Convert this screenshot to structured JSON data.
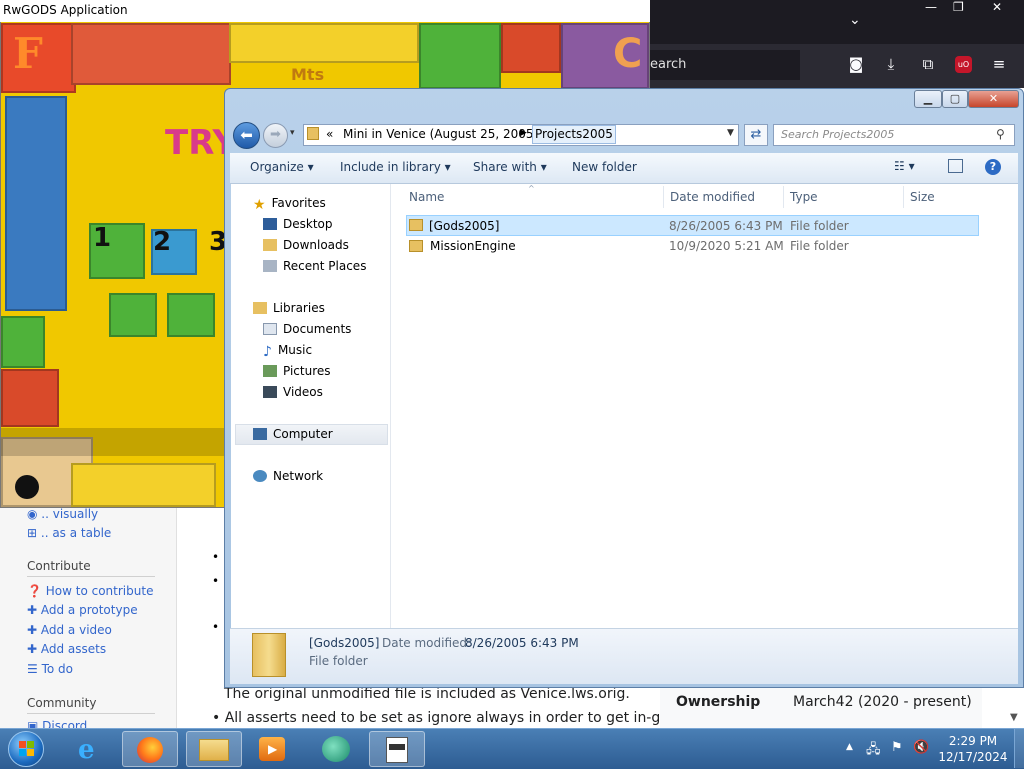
{
  "game_window": {
    "title": "RwGODS Application"
  },
  "browser": {
    "search_placeholder": "earch",
    "icons": [
      "chevron-down-icon",
      "pocket-icon",
      "download-icon",
      "extension-icon",
      "ublock-icon",
      "menu-icon"
    ],
    "window_controls": [
      "—",
      "❐",
      "✕"
    ]
  },
  "wiki": {
    "link_visually": ".. visually",
    "link_table": ".. as a table",
    "contribute_heading": "Contribute",
    "contribute_links": [
      "How to contribute",
      "Add a prototype",
      "Add a video",
      "Add assets",
      "To do"
    ],
    "community_heading": "Community",
    "community_links": [
      "Discord"
    ],
    "content_line1": "The original unmodified file is included as Venice.lws.orig.",
    "content_line2": "All asserts need to be set as ignore always in order to get in-game.",
    "ownership_label": "Ownership",
    "ownership_value": "March42 (2020 - present)"
  },
  "explorer": {
    "breadcrumb_prefix": "«",
    "breadcrumb": [
      "Mini in Venice (August 25, 2005)",
      "Projects2005"
    ],
    "search_placeholder": "Search Projects2005",
    "toolbar": [
      "Organize",
      "Include in library",
      "Share with",
      "New folder"
    ],
    "nav": {
      "favorites": "Favorites",
      "favorites_items": [
        "Desktop",
        "Downloads",
        "Recent Places"
      ],
      "libraries": "Libraries",
      "libraries_items": [
        "Documents",
        "Music",
        "Pictures",
        "Videos"
      ],
      "computer": "Computer",
      "network": "Network"
    },
    "columns": [
      "Name",
      "Date modified",
      "Type",
      "Size"
    ],
    "files": [
      {
        "name": "[Gods2005]",
        "date": "8/26/2005 6:43 PM",
        "type": "File folder",
        "size": ""
      },
      {
        "name": "MissionEngine",
        "date": "10/9/2020 5:21 AM",
        "type": "File folder",
        "size": ""
      }
    ],
    "details": {
      "name": "[Gods2005]",
      "date_label": "Date modified:",
      "date_value": "8/26/2005 6:43 PM",
      "type": "File folder"
    }
  },
  "taskbar": {
    "time": "2:29 PM",
    "date": "12/17/2024",
    "items": [
      "start-button",
      "internet-explorer",
      "firefox",
      "windows-explorer",
      "media-player",
      "media-center",
      "rwgods-app"
    ]
  },
  "colors": {
    "accent": "#3399ff",
    "selection": "#cce8ff",
    "taskbar": "#2d5c92",
    "link": "#3366cc"
  }
}
